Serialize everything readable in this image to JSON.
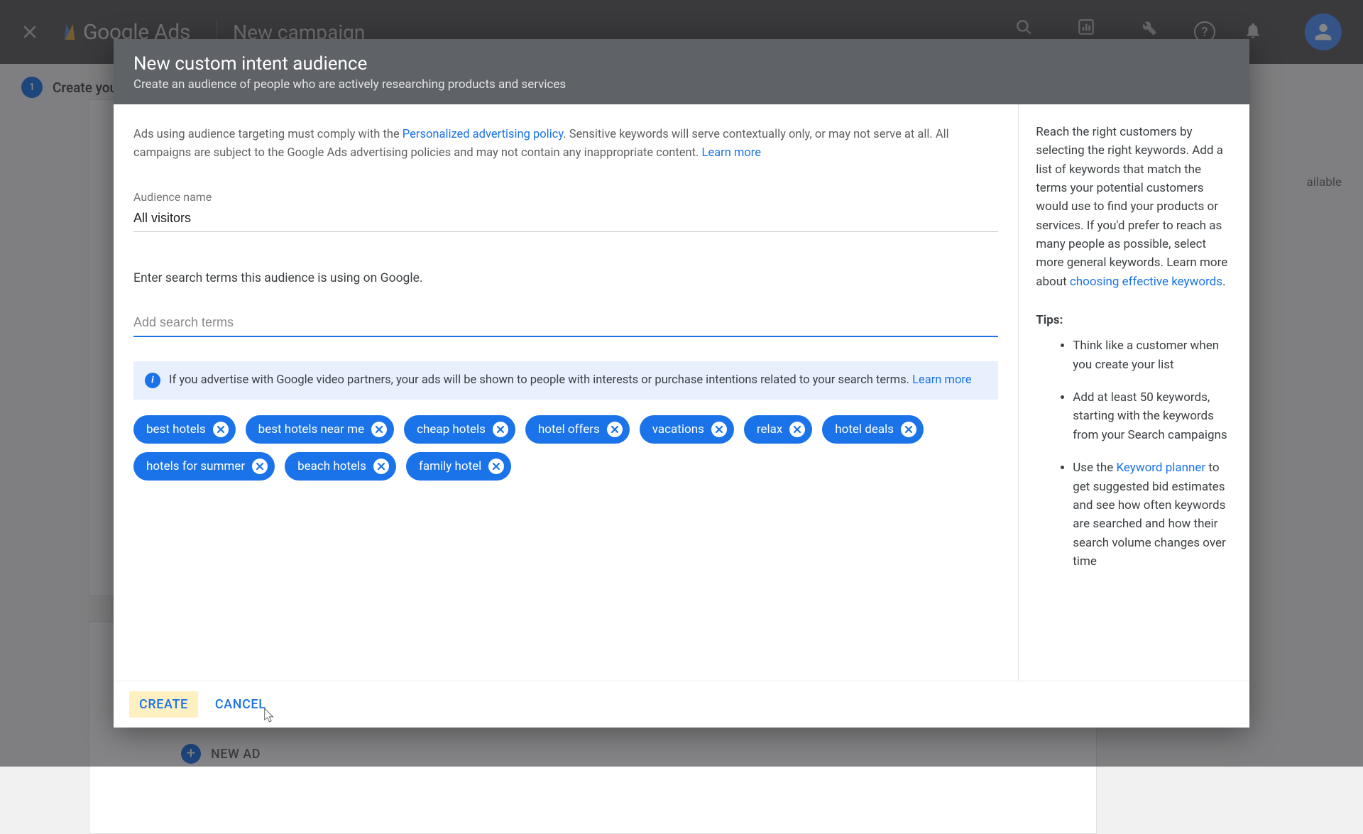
{
  "topbar": {
    "brand": "Google Ads",
    "page_title": "New campaign",
    "tools": {
      "search": "SEARCH",
      "reports": "REPORTS",
      "tools": "TOOLS &"
    }
  },
  "background": {
    "step_number": "1",
    "step_text": "Create you",
    "side_text": "ailable",
    "new_ad": "NEW AD"
  },
  "modal": {
    "title": "New custom intent audience",
    "subtitle": "Create an audience of people who are actively researching products and services",
    "policy_pre": "Ads using audience targeting must comply with the ",
    "policy_link": "Personalized advertising policy",
    "policy_post": ". Sensitive keywords will serve contextually only, or may not serve at all. All campaigns are subject to the Google Ads advertising policies and may not contain any inappropriate content. ",
    "learn_more": "Learn more",
    "audience_name_label": "Audience name",
    "audience_name_value": "All visitors",
    "instruction": "Enter search terms this audience is using on Google.",
    "search_placeholder": "Add search terms",
    "info_banner_text": "If you advertise with Google video partners, your ads will be shown to people with interests or purchase intentions related to your search terms. ",
    "info_learn_more": "Learn more",
    "chips": [
      "best hotels",
      "best hotels near me",
      "cheap hotels",
      "hotel offers",
      "vacations",
      "relax",
      "hotel deals",
      "hotels for summer",
      "beach hotels",
      "family hotel"
    ],
    "footer": {
      "create": "CREATE",
      "cancel": "CANCEL"
    }
  },
  "sidebar": {
    "intro": "Reach the right customers by selecting the right keywords. Add a list of keywords that match the terms your potential customers would use to find your products or services. If you'd prefer to reach as many people as possible, select more general keywords. Learn more about ",
    "intro_link": "choosing effective keywords",
    "tips_label": "Tips:",
    "tips": [
      {
        "pre": "Think like a customer when you create your list",
        "link": "",
        "post": ""
      },
      {
        "pre": "Add at least 50 keywords, starting with the keywords from your Search campaigns",
        "link": "",
        "post": ""
      },
      {
        "pre": "Use the ",
        "link": "Keyword planner",
        "post": " to get suggested bid estimates and see how often keywords are searched and how their search volume changes over time"
      }
    ]
  }
}
